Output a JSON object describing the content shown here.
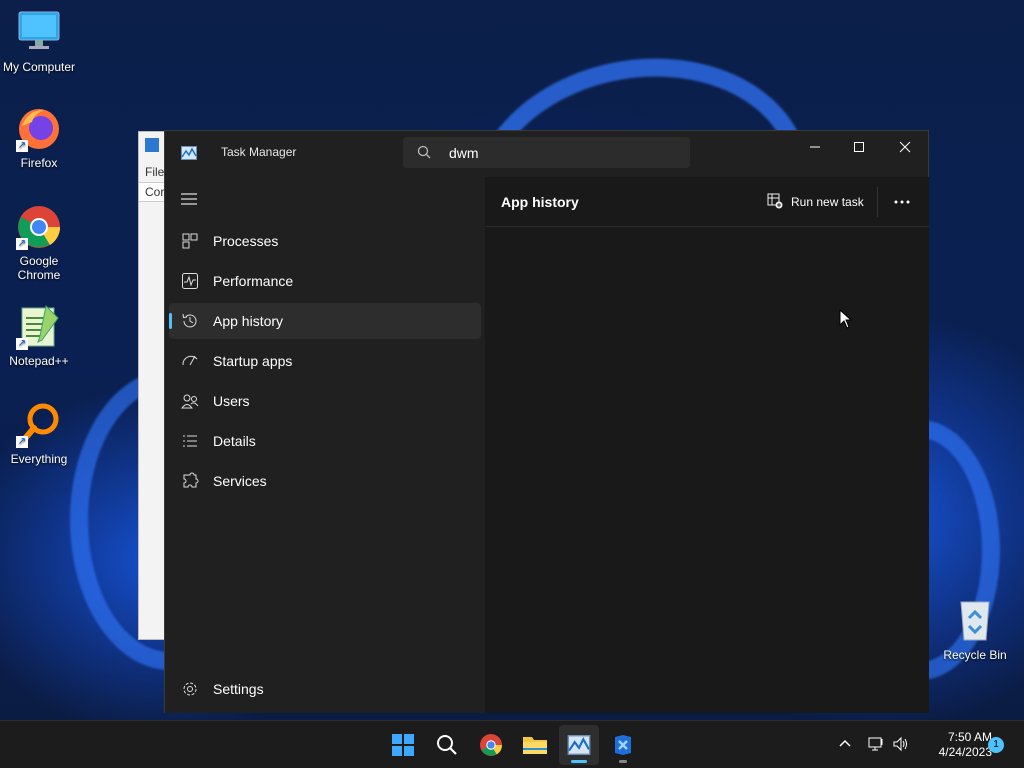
{
  "desktop": {
    "icons": [
      {
        "label": "My Computer",
        "icon": "monitor-icon"
      },
      {
        "label": "Firefox",
        "icon": "firefox-icon"
      },
      {
        "label": "Google Chrome",
        "icon": "chrome-icon"
      },
      {
        "label": "Notepad++",
        "icon": "notepadpp-icon"
      },
      {
        "label": "Everything",
        "icon": "everything-icon"
      }
    ],
    "recycle_bin": {
      "label": "Recycle Bin",
      "icon": "recycle-bin-icon"
    }
  },
  "background_window": {
    "menu_fragment": "File",
    "text_fragment": "Cor"
  },
  "task_manager": {
    "title": "Task Manager",
    "search": {
      "value": "dwm",
      "icon": "search-icon"
    },
    "window_controls": {
      "minimize": "minimize-icon",
      "maximize": "maximize-icon",
      "close": "close-icon"
    },
    "nav": {
      "items": [
        {
          "label": "Processes",
          "icon": "processes-icon"
        },
        {
          "label": "Performance",
          "icon": "performance-icon"
        },
        {
          "label": "App history",
          "icon": "history-icon",
          "active": true
        },
        {
          "label": "Startup apps",
          "icon": "startup-icon"
        },
        {
          "label": "Users",
          "icon": "users-icon"
        },
        {
          "label": "Details",
          "icon": "details-icon"
        },
        {
          "label": "Services",
          "icon": "services-icon"
        }
      ],
      "settings": {
        "label": "Settings",
        "icon": "gear-icon"
      }
    },
    "main": {
      "page_title": "App history",
      "run_new_task": "Run new task",
      "more_icon": "more-icon"
    },
    "accent_color": "#4cc2ff"
  },
  "taskbar": {
    "apps": [
      "start-icon",
      "search-icon",
      "chrome-icon",
      "file-explorer-icon",
      "task-manager-icon",
      "app-icon"
    ],
    "clock": {
      "time": "7:50 AM",
      "date": "4/24/2023"
    },
    "notification_count": "1"
  }
}
